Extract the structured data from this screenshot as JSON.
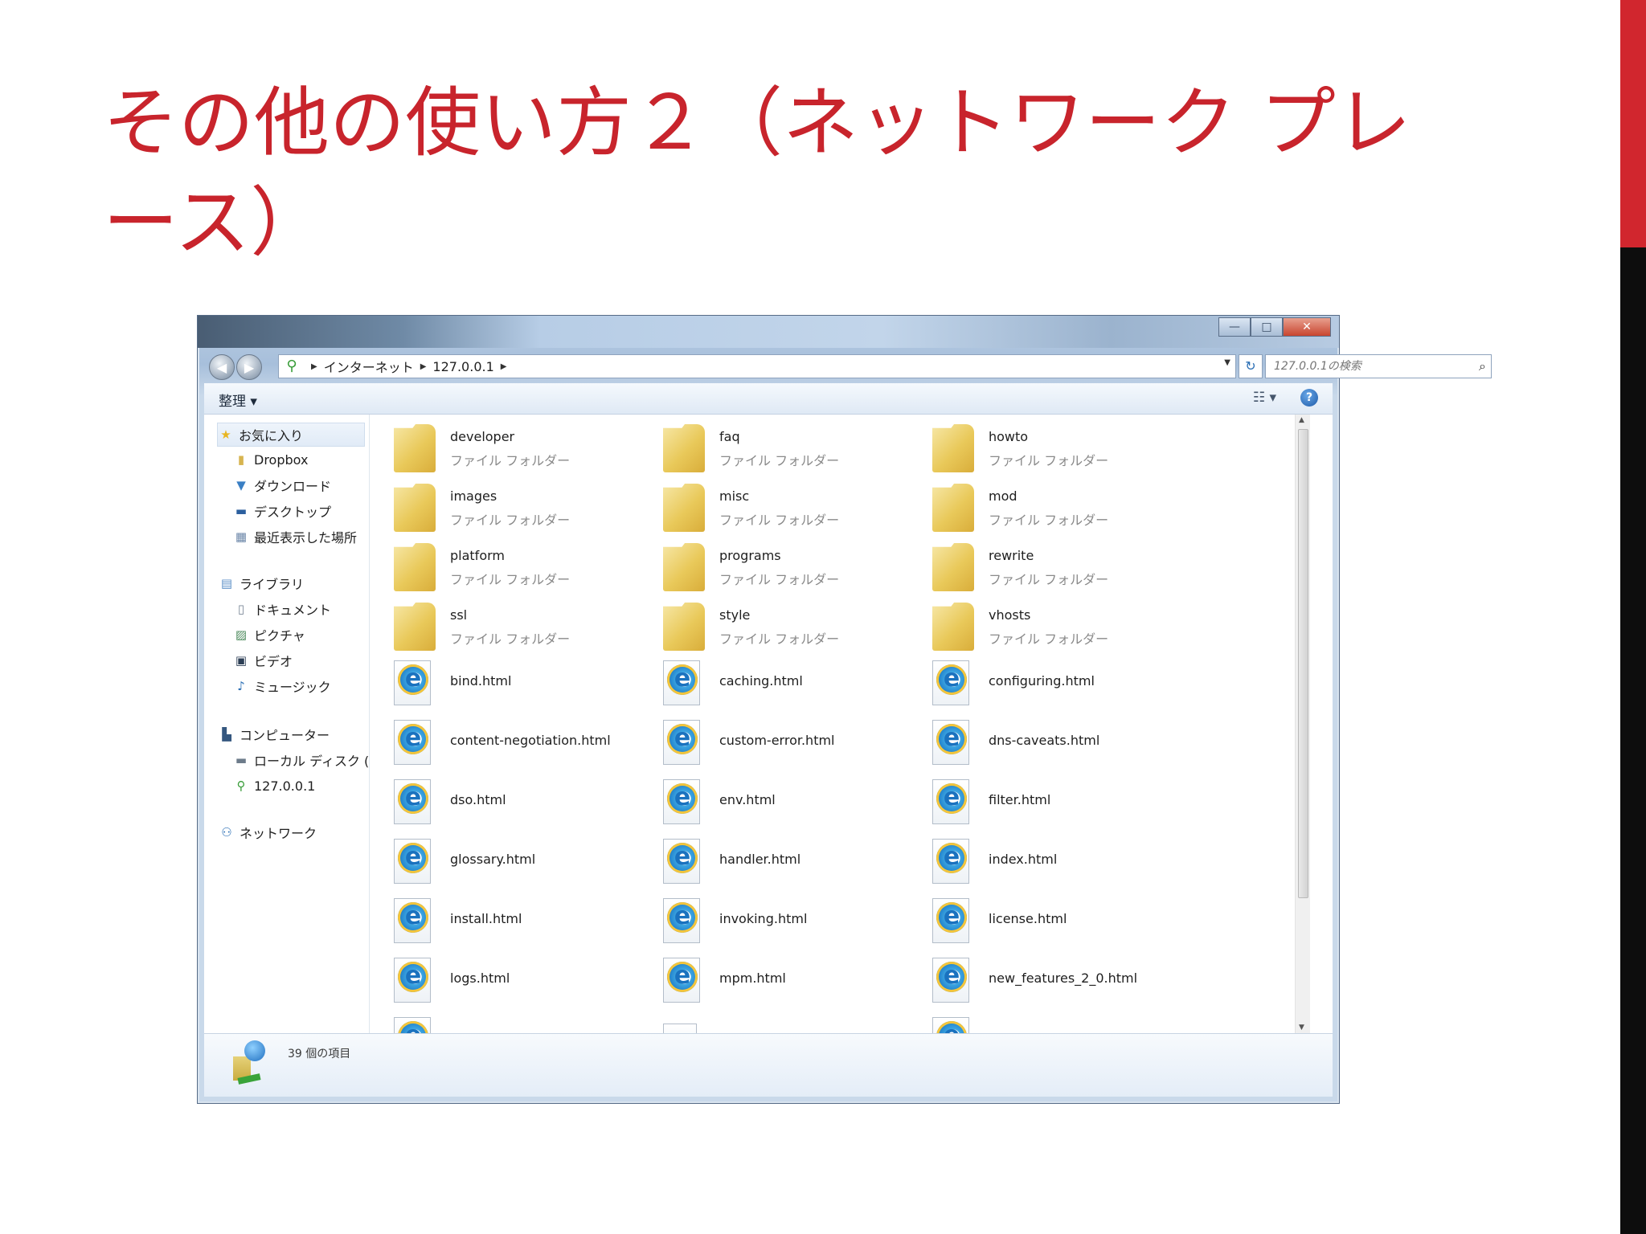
{
  "slide": {
    "title": "その他の使い方２（ネットワーク プレース）"
  },
  "window": {
    "controls": {
      "minimize": "—",
      "maximize": "□",
      "close": "✕"
    },
    "address": {
      "crumbs": [
        "インターネット",
        "127.0.0.1"
      ],
      "search_placeholder": "127.0.0.1の検索"
    },
    "toolbar": {
      "organize_label": "整理 ▾",
      "view_label": "☷ ▾",
      "help_label": "?"
    },
    "nav": {
      "favorites": {
        "label": "お気に入り",
        "items": [
          "Dropbox",
          "ダウンロード",
          "デスクトップ",
          "最近表示した場所"
        ]
      },
      "libraries": {
        "label": "ライブラリ",
        "items": [
          "ドキュメント",
          "ピクチャ",
          "ビデオ",
          "ミュージック"
        ]
      },
      "computer": {
        "label": "コンピューター",
        "items": [
          "ローカル ディスク (",
          "127.0.0.1"
        ]
      },
      "network": {
        "label": "ネットワーク"
      }
    },
    "folder_type_label": "ファイル フォルダー",
    "folders": [
      "developer",
      "faq",
      "howto",
      "images",
      "misc",
      "mod",
      "platform",
      "programs",
      "rewrite",
      "ssl",
      "style",
      "vhosts"
    ],
    "html_files": [
      "bind.html",
      "caching.html",
      "configuring.html",
      "content-negotiation.html",
      "custom-error.html",
      "dns-caveats.html",
      "dso.html",
      "env.html",
      "filter.html",
      "glossary.html",
      "handler.html",
      "index.html",
      "install.html",
      "invoking.html",
      "license.html",
      "logs.html",
      "mpm.html",
      "new_features_2_0.html"
    ],
    "status": {
      "item_count": "39 個の項目"
    }
  }
}
